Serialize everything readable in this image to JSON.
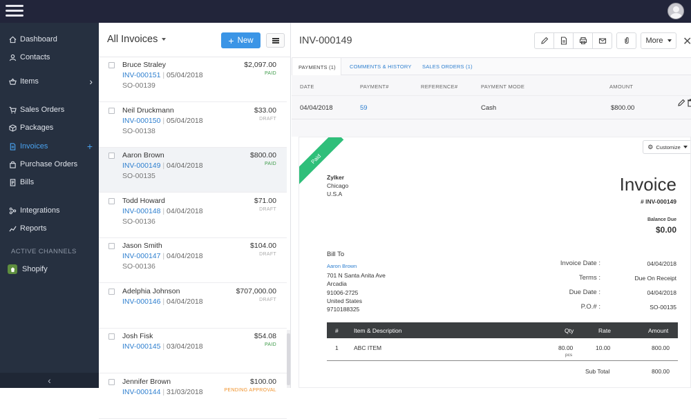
{
  "sidebar": {
    "items": [
      {
        "label": "Dashboard",
        "icon": "home-icon"
      },
      {
        "label": "Contacts",
        "icon": "user-icon"
      },
      {
        "label": "Items",
        "icon": "basket-icon",
        "trail": "›"
      },
      {
        "label": "Sales Orders",
        "icon": "cart-icon"
      },
      {
        "label": "Packages",
        "icon": "package-icon"
      },
      {
        "label": "Invoices",
        "icon": "document-icon",
        "trail": "+",
        "active": true
      },
      {
        "label": "Purchase Orders",
        "icon": "bag-icon"
      },
      {
        "label": "Bills",
        "icon": "bill-icon"
      },
      {
        "label": "Integrations",
        "icon": "integrations-icon"
      },
      {
        "label": "Reports",
        "icon": "chart-icon"
      }
    ],
    "channels_title": "ACTIVE CHANNELS",
    "channel": {
      "label": "Shopify",
      "icon": "shopify-icon"
    },
    "collapse_icon": "‹"
  },
  "list": {
    "title": "All Invoices",
    "new_label": "New",
    "rows": [
      {
        "customer": "Bruce Straley",
        "invoice": "INV-000151",
        "date": "05/04/2018",
        "so": "SO-00139",
        "amount": "$2,097.00",
        "status": "PAID"
      },
      {
        "customer": "Neil Druckmann",
        "invoice": "INV-000150",
        "date": "05/04/2018",
        "so": "SO-00138",
        "amount": "$33.00",
        "status": "DRAFT"
      },
      {
        "customer": "Aaron Brown",
        "invoice": "INV-000149",
        "date": "04/04/2018",
        "so": "SO-00135",
        "amount": "$800.00",
        "status": "PAID"
      },
      {
        "customer": "Todd Howard",
        "invoice": "INV-000148",
        "date": "04/04/2018",
        "so": "SO-00136",
        "amount": "$71.00",
        "status": "DRAFT"
      },
      {
        "customer": "Jason Smith",
        "invoice": "INV-000147",
        "date": "04/04/2018",
        "so": "SO-00136",
        "amount": "$104.00",
        "status": "DRAFT"
      },
      {
        "customer": "Adelphia Johnson",
        "invoice": "INV-000146",
        "date": "04/04/2018",
        "so": "",
        "amount": "$707,000.00",
        "status": "DRAFT"
      },
      {
        "customer": "Josh Fisk",
        "invoice": "INV-000145",
        "date": "03/04/2018",
        "so": "",
        "amount": "$54.08",
        "status": "PAID"
      },
      {
        "customer": "Jennifer Brown",
        "invoice": "INV-000144",
        "date": "31/03/2018",
        "so": "",
        "amount": "$100.00",
        "status": "PENDING APPROVAL"
      }
    ]
  },
  "detail": {
    "title": "INV-000149",
    "more_label": "More",
    "tabs": [
      "PAYMENTS (1)",
      "COMMENTS & HISTORY",
      "SALES ORDERS (1)"
    ],
    "payments": {
      "headers": [
        "DATE",
        "PAYMENT#",
        "REFERENCE#",
        "PAYMENT MODE",
        "AMOUNT"
      ],
      "row": {
        "date": "04/04/2018",
        "payment": "59",
        "reference": "",
        "mode": "Cash",
        "amount": "$800.00"
      }
    },
    "document": {
      "ribbon": "Paid",
      "customize_label": "Customize",
      "from": {
        "name": "Zylker",
        "city": "Chicago",
        "country": "U.S.A"
      },
      "title": "Invoice",
      "number": "# INV-000149",
      "balance_label": "Balance Due",
      "balance_value": "$0.00",
      "bill_to_label": "Bill To",
      "bill_to": {
        "name": "Aaron Brown",
        "line1": "701 N Santa Anita Ave",
        "line2": "Arcadia",
        "line3": "91006-2725",
        "line4": "United States",
        "line5": "9710188325"
      },
      "fields": [
        {
          "label": "Invoice Date :",
          "value": "04/04/2018"
        },
        {
          "label": "Terms :",
          "value": "Due On Receipt"
        },
        {
          "label": "Due Date :",
          "value": "04/04/2018"
        },
        {
          "label": "P.O.# :",
          "value": "SO-00135"
        }
      ],
      "table_headers": [
        "#",
        "Item & Description",
        "Qty",
        "Rate",
        "Amount"
      ],
      "item": {
        "num": "1",
        "desc": "ABC ITEM",
        "qty": "80.00",
        "unit": "pcs",
        "rate": "10.00",
        "amount": "800.00"
      },
      "subtotal_label": "Sub Total",
      "subtotal_value": "800.00"
    }
  },
  "colors": {
    "topbar": "#22253a",
    "sidebar": "#263040",
    "accent": "#3b95e6",
    "paid": "#3e9b4a",
    "pending": "#f0922b",
    "ribbon": "#2fbf7a"
  }
}
